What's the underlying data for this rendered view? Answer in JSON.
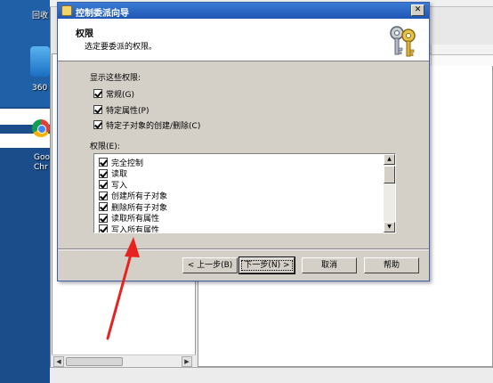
{
  "desktop": {
    "icon_top_label": "回收",
    "icon_360_label": "360",
    "icon_chrome_label_1": "Goo",
    "icon_chrome_label_2": "Chr"
  },
  "dialog": {
    "title": "控制委派向导",
    "close_symbol": "✕",
    "header_title": "权限",
    "header_subtitle": "选定要委派的权限。",
    "show_label": "显示这些权限:",
    "show_options": [
      {
        "label": "常规(G)",
        "checked": true
      },
      {
        "label": "特定属性(P)",
        "checked": true
      },
      {
        "label": "特定子对象的创建/删除(C)",
        "checked": true
      }
    ],
    "permissions_label": "权限(E):",
    "permissions": [
      {
        "label": "完全控制",
        "checked": true
      },
      {
        "label": "读取",
        "checked": true
      },
      {
        "label": "写入",
        "checked": true
      },
      {
        "label": "创建所有子对象",
        "checked": true
      },
      {
        "label": "删除所有子对象",
        "checked": true
      },
      {
        "label": "读取所有属性",
        "checked": true
      },
      {
        "label": "写入所有属性",
        "checked": true
      }
    ],
    "buttons": {
      "back": "< 上一步(B)",
      "next": "下一步(N) >",
      "cancel": "取消",
      "help": "帮助"
    }
  },
  "annotation": {
    "arrow_color": "#e8231f"
  }
}
